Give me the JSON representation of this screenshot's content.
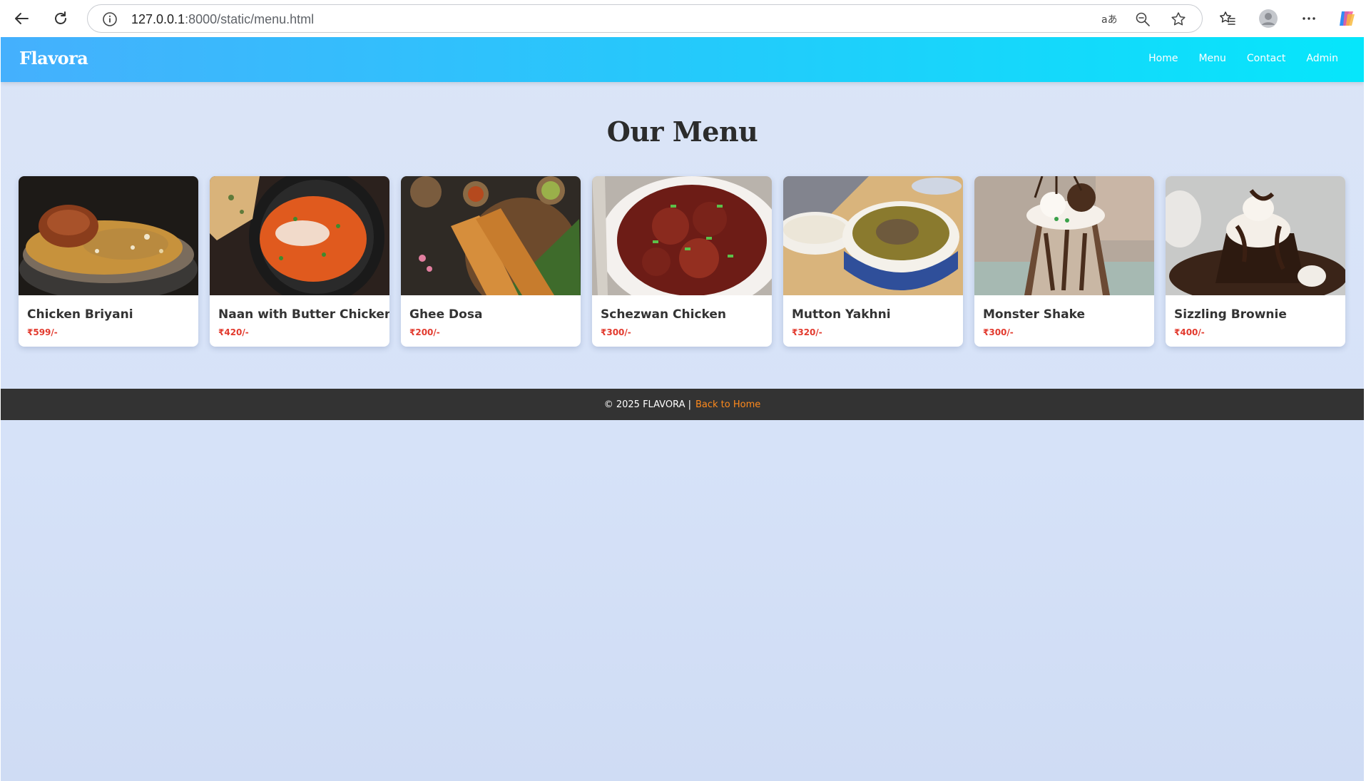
{
  "browser": {
    "url_host": "127.0.0.1",
    "url_path": ":8000/static/menu.html"
  },
  "site": {
    "brand": "Flavora",
    "nav": [
      "Home",
      "Menu",
      "Contact",
      "Admin"
    ],
    "page_title": "Our Menu"
  },
  "menu": {
    "items": [
      {
        "name": "Chicken Briyani",
        "price": "₹599/-"
      },
      {
        "name": "Naan with Butter Chicken",
        "price": "₹420/-"
      },
      {
        "name": "Ghee Dosa",
        "price": "₹200/-"
      },
      {
        "name": "Schezwan Chicken",
        "price": "₹300/-"
      },
      {
        "name": "Mutton Yakhni",
        "price": "₹320/-"
      },
      {
        "name": "Monster Shake",
        "price": "₹300/-"
      },
      {
        "name": "Sizzling Brownie",
        "price": "₹400/-"
      }
    ]
  },
  "footer": {
    "copyright": "© 2025 FLAVORA |",
    "link": "Back to Home"
  },
  "colors": {
    "header_start": "#45b0fd",
    "header_end": "#06e6fb",
    "price": "#e23a2e",
    "footer_bg": "#333333",
    "footer_link": "#ff8a1c"
  }
}
